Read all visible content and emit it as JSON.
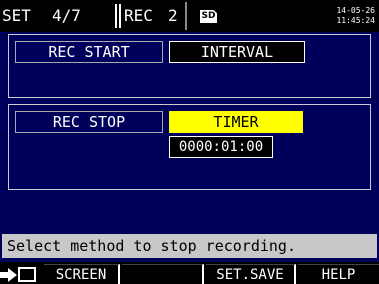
{
  "header": {
    "set_label": "SET",
    "page": "4/7",
    "rec_label": "REC",
    "rec_number": "2",
    "sd_icon": "SD",
    "date": "14-05-26",
    "time": "11:45:24"
  },
  "rec_start": {
    "label": "REC START",
    "value": "INTERVAL"
  },
  "rec_stop": {
    "label": "REC STOP",
    "value": "TIMER",
    "timer_value": "0000:01:00"
  },
  "message": "Select method to stop recording.",
  "function_keys": {
    "icon": "screen-switch-arrow-icon",
    "screen": "SCREEN",
    "blank": "",
    "set_save": "SET.SAVE",
    "help": "HELP"
  },
  "colors": {
    "background": "#00005a",
    "highlight": "#ffff00",
    "message_bar": "#c8c8c8"
  }
}
